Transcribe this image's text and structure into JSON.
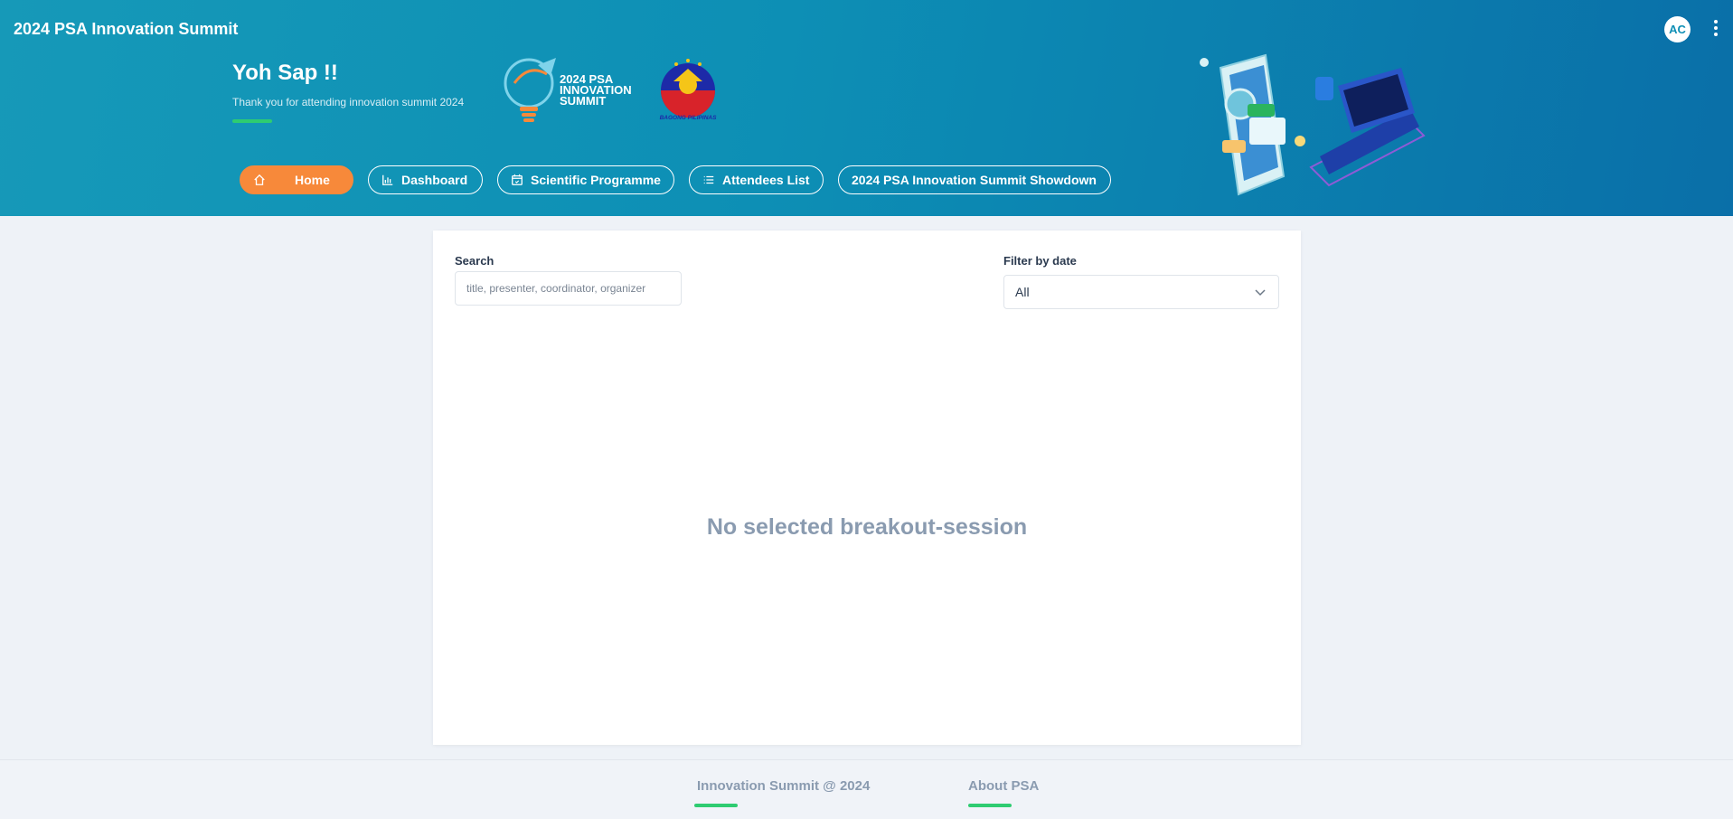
{
  "header": {
    "app_title": "2024 PSA Innovation Summit",
    "avatar_initials": "AC",
    "greeting": "Yoh Sap !!",
    "subtitle": "Thank you for attending innovation summit 2024",
    "summit_logo_lines": [
      "2024 PSA",
      "INNOVATION",
      "SUMMIT"
    ],
    "bagong_pilipinas": "BAGONG PILIPINAS"
  },
  "nav": [
    {
      "label": "Home",
      "icon": "home-icon",
      "active": true
    },
    {
      "label": "Dashboard",
      "icon": "bar-chart-icon"
    },
    {
      "label": "Scientific Programme",
      "icon": "calendar-icon"
    },
    {
      "label": "Attendees List",
      "icon": "list-icon"
    },
    {
      "label": "2024 PSA Innovation Summit Showdown"
    }
  ],
  "search": {
    "label": "Search",
    "placeholder": "title, presenter, coordinator, organizer",
    "value": ""
  },
  "filter": {
    "label": "Filter by date",
    "value": "All"
  },
  "empty_message": "No selected breakout-session",
  "footer": {
    "links": [
      "Innovation Summit @ 2024",
      "About PSA"
    ]
  },
  "colors": {
    "header_start": "#1699b8",
    "header_end": "#0a6fa8",
    "active_nav": "#f7893a",
    "accent_green": "#2ecc71",
    "muted_text": "#8a9bb0"
  }
}
